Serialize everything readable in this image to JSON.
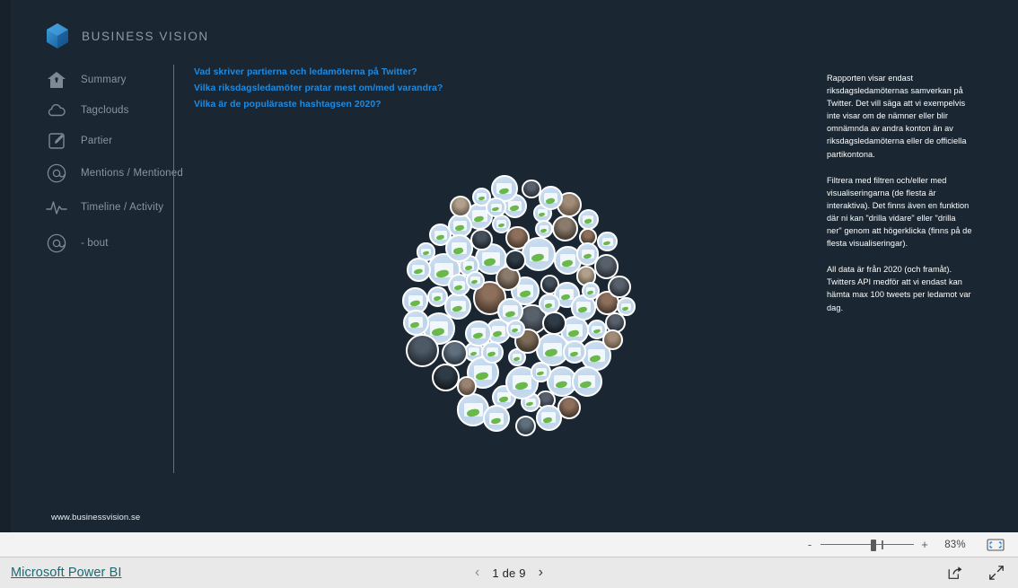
{
  "brand": {
    "name": "BUSINESS VISION",
    "logo_icon": "hexagon-cube-logo",
    "accent_color": "#2a7fc9"
  },
  "sidebar": {
    "items": [
      {
        "label": "Summary",
        "icon": "home-icon"
      },
      {
        "label": "Tagclouds",
        "icon": "cloud-icon"
      },
      {
        "label": "Partier",
        "icon": "edit-note-icon"
      },
      {
        "label": "Mentions / Mentioned",
        "icon": "at-sign-icon"
      },
      {
        "label": "Timeline / Activity",
        "icon": "activity-pulse-icon"
      },
      {
        "label": "- bout",
        "icon": "at-sign-icon"
      }
    ]
  },
  "questions": [
    "Vad skriver partierna och ledamöterna på Twitter?",
    "Vilka riksdagsledamöter pratar mest om/med varandra?",
    "Vilka är de populäraste hashtagsen 2020?"
  ],
  "info_panel": {
    "paragraphs": [
      "Rapporten visar endast riksdagsledamöternas samverkan på Twitter. Det vill säga att vi exempelvis inte visar om de nämner eller blir omnämnda av andra konton än av riksdagsledamöterna eller de officiella partikontona.",
      "Filtrera med filtren och/eller med visualiseringarna (de flesta är interaktiva). Det finns även en funktion där ni kan \"drilla vidare\"  eller \"drilla ner\" genom att högerklicka (finns på de flesta visualiseringar).",
      "All data är från 2020 (och framåt). Twitters API medför att vi endast kan hämta max 100 tweets per ledamot var dag."
    ]
  },
  "site_url": "www.businessvision.se",
  "zoom_bar": {
    "minus_label": "-",
    "plus_label": "+",
    "percent": "83%",
    "fit_icon": "fit-to-page-icon"
  },
  "action_bar": {
    "powerbi_link": "Microsoft Power BI",
    "prev_icon": "chevron-left-icon",
    "next_icon": "chevron-right-icon",
    "page_label": "1 de 9",
    "share_icon": "share-icon",
    "fullscreen_icon": "fullscreen-icon"
  },
  "visual": {
    "name": "profile-avatar-cluster",
    "node_count": 104
  }
}
